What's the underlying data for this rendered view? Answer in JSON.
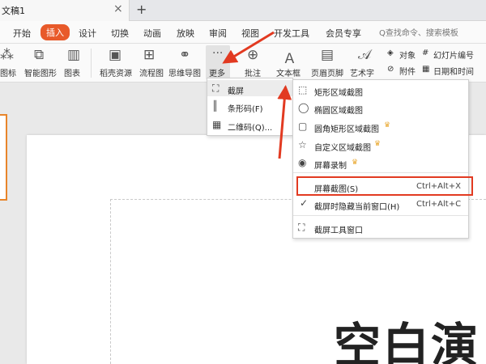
{
  "window": {
    "doc_title": "文稿1",
    "close_glyph": "×",
    "new_tab_glyph": "+"
  },
  "menubar": {
    "tabs": [
      "开始",
      "插入",
      "设计",
      "切换",
      "动画",
      "放映",
      "审阅",
      "视图",
      "开发工具",
      "会员专享"
    ],
    "active_tab": "插入",
    "search_placeholder": "Q查找命令、搜索模板"
  },
  "ribbon": {
    "items": {
      "icon_label": "图标",
      "smartart_label": "智能图形",
      "chart_label": "图表",
      "docer_label": "稻壳资源",
      "flowchart_label": "流程图",
      "mindmap_label": "思维导图",
      "more_label": "更多",
      "comment_label": "批注",
      "textbox_label": "文本框",
      "headerfooter_label": "页眉页脚",
      "wordart_label": "艺术字",
      "object_label": "对象",
      "slide_number_label": "幻灯片编号",
      "attachment_label": "附件",
      "datetime_label": "日期和时间"
    }
  },
  "more_menu": {
    "items": [
      {
        "label": "截屏",
        "icon": "screenshot-icon",
        "has_submenu": true
      },
      {
        "label": "条形码(F)",
        "icon": "barcode-icon"
      },
      {
        "label": "二维码(Q)...",
        "icon": "qrcode-icon"
      }
    ]
  },
  "screenshot_submenu": {
    "items": [
      {
        "label": "矩形区域截图",
        "icon": "rectangle-icon"
      },
      {
        "label": "椭圆区域截图",
        "icon": "ellipse-icon"
      },
      {
        "label": "圆角矩形区域截图",
        "icon": "rounded-rect-icon",
        "premium": true
      },
      {
        "label": "自定义区域截图",
        "icon": "custom-area-icon",
        "premium": true
      },
      {
        "label": "屏幕录制",
        "icon": "screen-record-icon",
        "premium": true
      },
      {
        "label": "屏幕截图(S)",
        "shortcut": "Ctrl+Alt+X",
        "highlighted": true
      },
      {
        "label": "截屏时隐藏当前窗口(H)",
        "shortcut": "Ctrl+Alt+C",
        "checked": true
      },
      {
        "label": "截屏工具窗口",
        "icon": "screenshot-tool-icon"
      }
    ]
  },
  "slide": {
    "title": "空白演"
  },
  "colors": {
    "accent": "#e85a2a",
    "highlight_box": "#e23a21",
    "arrow": "#e23a21",
    "crown": "#e9a830"
  }
}
